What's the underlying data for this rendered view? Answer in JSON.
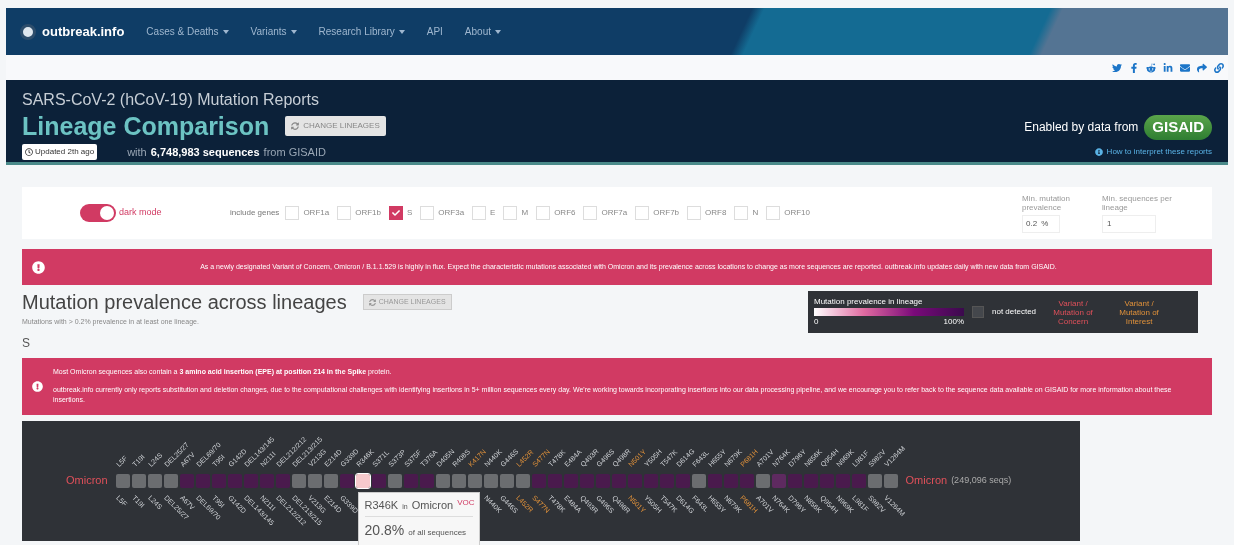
{
  "nav": {
    "brand": "outbreak.info",
    "items": [
      {
        "label": "Cases & Deaths",
        "dropdown": true
      },
      {
        "label": "Variants",
        "dropdown": true
      },
      {
        "label": "Research Library",
        "dropdown": true
      },
      {
        "label": "API",
        "dropdown": false
      },
      {
        "label": "About",
        "dropdown": true
      }
    ]
  },
  "header": {
    "subtitle": "SARS-CoV-2 (hCoV-19) Mutation Reports",
    "title": "Lineage Comparison",
    "change_button": "CHANGE LINEAGES",
    "updated": "Updated 2th ago",
    "count_prefix": "with",
    "count": "6,748,983 sequences",
    "count_suffix": "from GISAID",
    "enabled_by": "Enabled by data from",
    "gisaid": "GISAID",
    "help_link": "How to interpret these reports"
  },
  "controls": {
    "dark_mode": {
      "label": "dark mode",
      "on": true
    },
    "genes_label": "include genes",
    "genes": [
      {
        "label": "ORF1a",
        "checked": false
      },
      {
        "label": "ORF1b",
        "checked": false
      },
      {
        "label": "S",
        "checked": true
      },
      {
        "label": "ORF3a",
        "checked": false
      },
      {
        "label": "E",
        "checked": false
      },
      {
        "label": "M",
        "checked": false
      },
      {
        "label": "ORF6",
        "checked": false
      },
      {
        "label": "ORF7a",
        "checked": false
      },
      {
        "label": "ORF7b",
        "checked": false
      },
      {
        "label": "ORF8",
        "checked": false
      },
      {
        "label": "N",
        "checked": false
      },
      {
        "label": "ORF10",
        "checked": false
      }
    ],
    "min_prevalence": {
      "label": "Min. mutation prevalence",
      "value": "0.2",
      "unit": "%"
    },
    "min_sequences": {
      "label": "Min. sequences per lineage",
      "value": "1"
    }
  },
  "alert": "As a newly designated Variant of Concern, Omicron / B.1.1.529 is highly in flux. Expect the characteristic mutations associated with Omicron and its prevalence across locations to change as more sequences are reported. outbreak.info updates daily with new data from GISAID.",
  "section": {
    "title": "Mutation prevalence across lineages",
    "change_button": "CHANGE LINEAGES",
    "subtitle": "Mutations with > 0.2% prevalence in at least one lineage.",
    "gene": "S"
  },
  "legend": {
    "title": "Mutation prevalence in lineage",
    "min": "0",
    "max": "100%",
    "not_detected": "not detected",
    "concern": "Variant / Mutation of Concern",
    "interest": "Variant / Mutation of Interest"
  },
  "insertion_notes": [
    "Most Omicron sequences also contain a **3 amino acid insertion (EPE) at position 214 in the Spike** protein.",
    "outbreak.info currently only reports substitution and deletion changes, due to the computational challenges with identifying insertions in 5+ million sequences every day. We're working towards incorporating insertions into our data processing pipeline, and we encourage you to refer back to the sequence data available on GISAID for more information about these insertions."
  ],
  "heatmap": {
    "lineage_left": "Omicron",
    "lineage_right": "Omicron",
    "seqs": "(249,096 seqs)",
    "tooltip": {
      "mutation": "R346K",
      "in": "in",
      "lineage": "Omicron",
      "badge": "VOC",
      "percent": "20.8%",
      "percent_label": "of all sequences"
    },
    "mutations": [
      {
        "label_top": "L5F",
        "label_bottom": "L5F",
        "kind": "other",
        "detected": false
      },
      {
        "label_top": "T19I",
        "label_bottom": "T19I",
        "kind": "other",
        "detected": false
      },
      {
        "label_top": "L24S",
        "label_bottom": "L24S",
        "kind": "other",
        "detected": false
      },
      {
        "label_top": "DEL25/27",
        "label_bottom": "DEL25/27",
        "kind": "other",
        "detected": false
      },
      {
        "label_top": "A67V",
        "label_bottom": "A67V",
        "kind": "other",
        "detected": true,
        "color": "#4a1a4d"
      },
      {
        "label_top": "DEL69/70",
        "label_bottom": "DEL69/70",
        "kind": "other",
        "detected": true,
        "color": "#4a1a4d"
      },
      {
        "label_top": "T95I",
        "label_bottom": "T95I",
        "kind": "other",
        "detected": true,
        "color": "#4a1a4d"
      },
      {
        "label_top": "G142D",
        "label_bottom": "G142D",
        "kind": "other",
        "detected": true,
        "color": "#4a1a4d"
      },
      {
        "label_top": "DEL143/145",
        "label_bottom": "DEL143/145",
        "kind": "other",
        "detected": true,
        "color": "#4a1a4d"
      },
      {
        "label_top": "N211I",
        "label_bottom": "N211I",
        "kind": "other",
        "detected": true,
        "color": "#4a1a4d"
      },
      {
        "label_top": "DEL212/212",
        "label_bottom": "DEL212/212",
        "kind": "other",
        "detected": true,
        "color": "#4a1a4d"
      },
      {
        "label_top": "DEL213/215",
        "label_bottom": "DEL213/215",
        "kind": "other",
        "detected": false
      },
      {
        "label_top": "V213G",
        "label_bottom": "V213G",
        "kind": "other",
        "detected": false
      },
      {
        "label_top": "E214D",
        "label_bottom": "E214D",
        "kind": "other",
        "detected": false
      },
      {
        "label_top": "G339D",
        "label_bottom": "G339D",
        "kind": "other",
        "detected": true,
        "color": "#4a1a4d"
      },
      {
        "label_top": "R346K",
        "kind": "other",
        "detected": true,
        "color": "#f6c9cc",
        "hovered": true
      },
      {
        "label_top": "S371L",
        "kind": "other",
        "detected": true,
        "color": "#4a1a4d",
        "hovered": false
      },
      {
        "label_top": "S373P",
        "kind": "other",
        "detected": false
      },
      {
        "label_top": "S375F",
        "kind": "other",
        "detected": true,
        "color": "#4a1a4d"
      },
      {
        "label_top": "T376A",
        "kind": "other",
        "detected": true,
        "color": "#4a1a4d"
      },
      {
        "label_top": "D405N",
        "kind": "other",
        "detected": false
      },
      {
        "label_top": "R408S",
        "kind": "other",
        "detected": false
      },
      {
        "label_top": "K417N",
        "kind": "interest",
        "detected": false
      },
      {
        "label_top": "N440K",
        "label_bottom": "N440K",
        "kind": "other",
        "detected": false
      },
      {
        "label_top": "G446S",
        "label_bottom": "G446S",
        "kind": "other",
        "detected": false
      },
      {
        "label_top": "L452R",
        "label_bottom": "L452R",
        "kind": "interest",
        "detected": false
      },
      {
        "label_top": "S477N",
        "label_bottom": "S477N",
        "kind": "interest",
        "detected": true,
        "color": "#4a1a4d"
      },
      {
        "label_top": "T478K",
        "label_bottom": "T478K",
        "kind": "other",
        "detected": true,
        "color": "#4a1a4d"
      },
      {
        "label_top": "E484A",
        "label_bottom": "E484A",
        "kind": "other",
        "detected": true,
        "color": "#4a1a4d"
      },
      {
        "label_top": "Q493R",
        "label_bottom": "Q493R",
        "kind": "other",
        "detected": true,
        "color": "#4a1a4d"
      },
      {
        "label_top": "G496S",
        "label_bottom": "G496S",
        "kind": "other",
        "detected": true,
        "color": "#4a1a4d"
      },
      {
        "label_top": "Q498R",
        "label_bottom": "Q498R",
        "kind": "other",
        "detected": true,
        "color": "#4a1a4d"
      },
      {
        "label_top": "N501Y",
        "label_bottom": "N501Y",
        "kind": "interest",
        "detected": true,
        "color": "#4a1a4d"
      },
      {
        "label_top": "Y505H",
        "label_bottom": "Y505H",
        "kind": "other",
        "detected": true,
        "color": "#4a1a4d"
      },
      {
        "label_top": "T547K",
        "label_bottom": "T547K",
        "kind": "other",
        "detected": true,
        "color": "#4a1a4d"
      },
      {
        "label_top": "D614G",
        "label_bottom": "D614G",
        "kind": "other",
        "detected": true,
        "color": "#4a1a4d"
      },
      {
        "label_top": "F643L",
        "label_bottom": "F643L",
        "kind": "other",
        "detected": false
      },
      {
        "label_top": "H655Y",
        "label_bottom": "H655Y",
        "kind": "other",
        "detected": true,
        "color": "#4a1a4d"
      },
      {
        "label_top": "N679K",
        "label_bottom": "N679K",
        "kind": "other",
        "detected": true,
        "color": "#4a1a4d"
      },
      {
        "label_top": "P681H",
        "label_bottom": "P681H",
        "kind": "interest",
        "detected": true,
        "color": "#4a1a4d"
      },
      {
        "label_top": "A701V",
        "label_bottom": "A701V",
        "kind": "other",
        "detected": false
      },
      {
        "label_top": "N764K",
        "label_bottom": "N764K",
        "kind": "other",
        "detected": true,
        "color": "#5e2a60"
      },
      {
        "label_top": "D796Y",
        "label_bottom": "D796Y",
        "kind": "other",
        "detected": true,
        "color": "#4a1a4d"
      },
      {
        "label_top": "N856K",
        "label_bottom": "N856K",
        "kind": "other",
        "detected": true,
        "color": "#4a1a4d"
      },
      {
        "label_top": "Q954H",
        "label_bottom": "Q954H",
        "kind": "other",
        "detected": true,
        "color": "#4a1a4d"
      },
      {
        "label_top": "N969K",
        "label_bottom": "N969K",
        "kind": "other",
        "detected": true,
        "color": "#4a1a4d"
      },
      {
        "label_top": "L981F",
        "label_bottom": "L981F",
        "kind": "other",
        "detected": true,
        "color": "#4a1a4d"
      },
      {
        "label_top": "S982V",
        "label_bottom": "S982V",
        "kind": "other",
        "detected": false
      },
      {
        "label_top": "V1264M",
        "label_bottom": "V1264M",
        "kind": "other",
        "detected": false
      }
    ]
  }
}
